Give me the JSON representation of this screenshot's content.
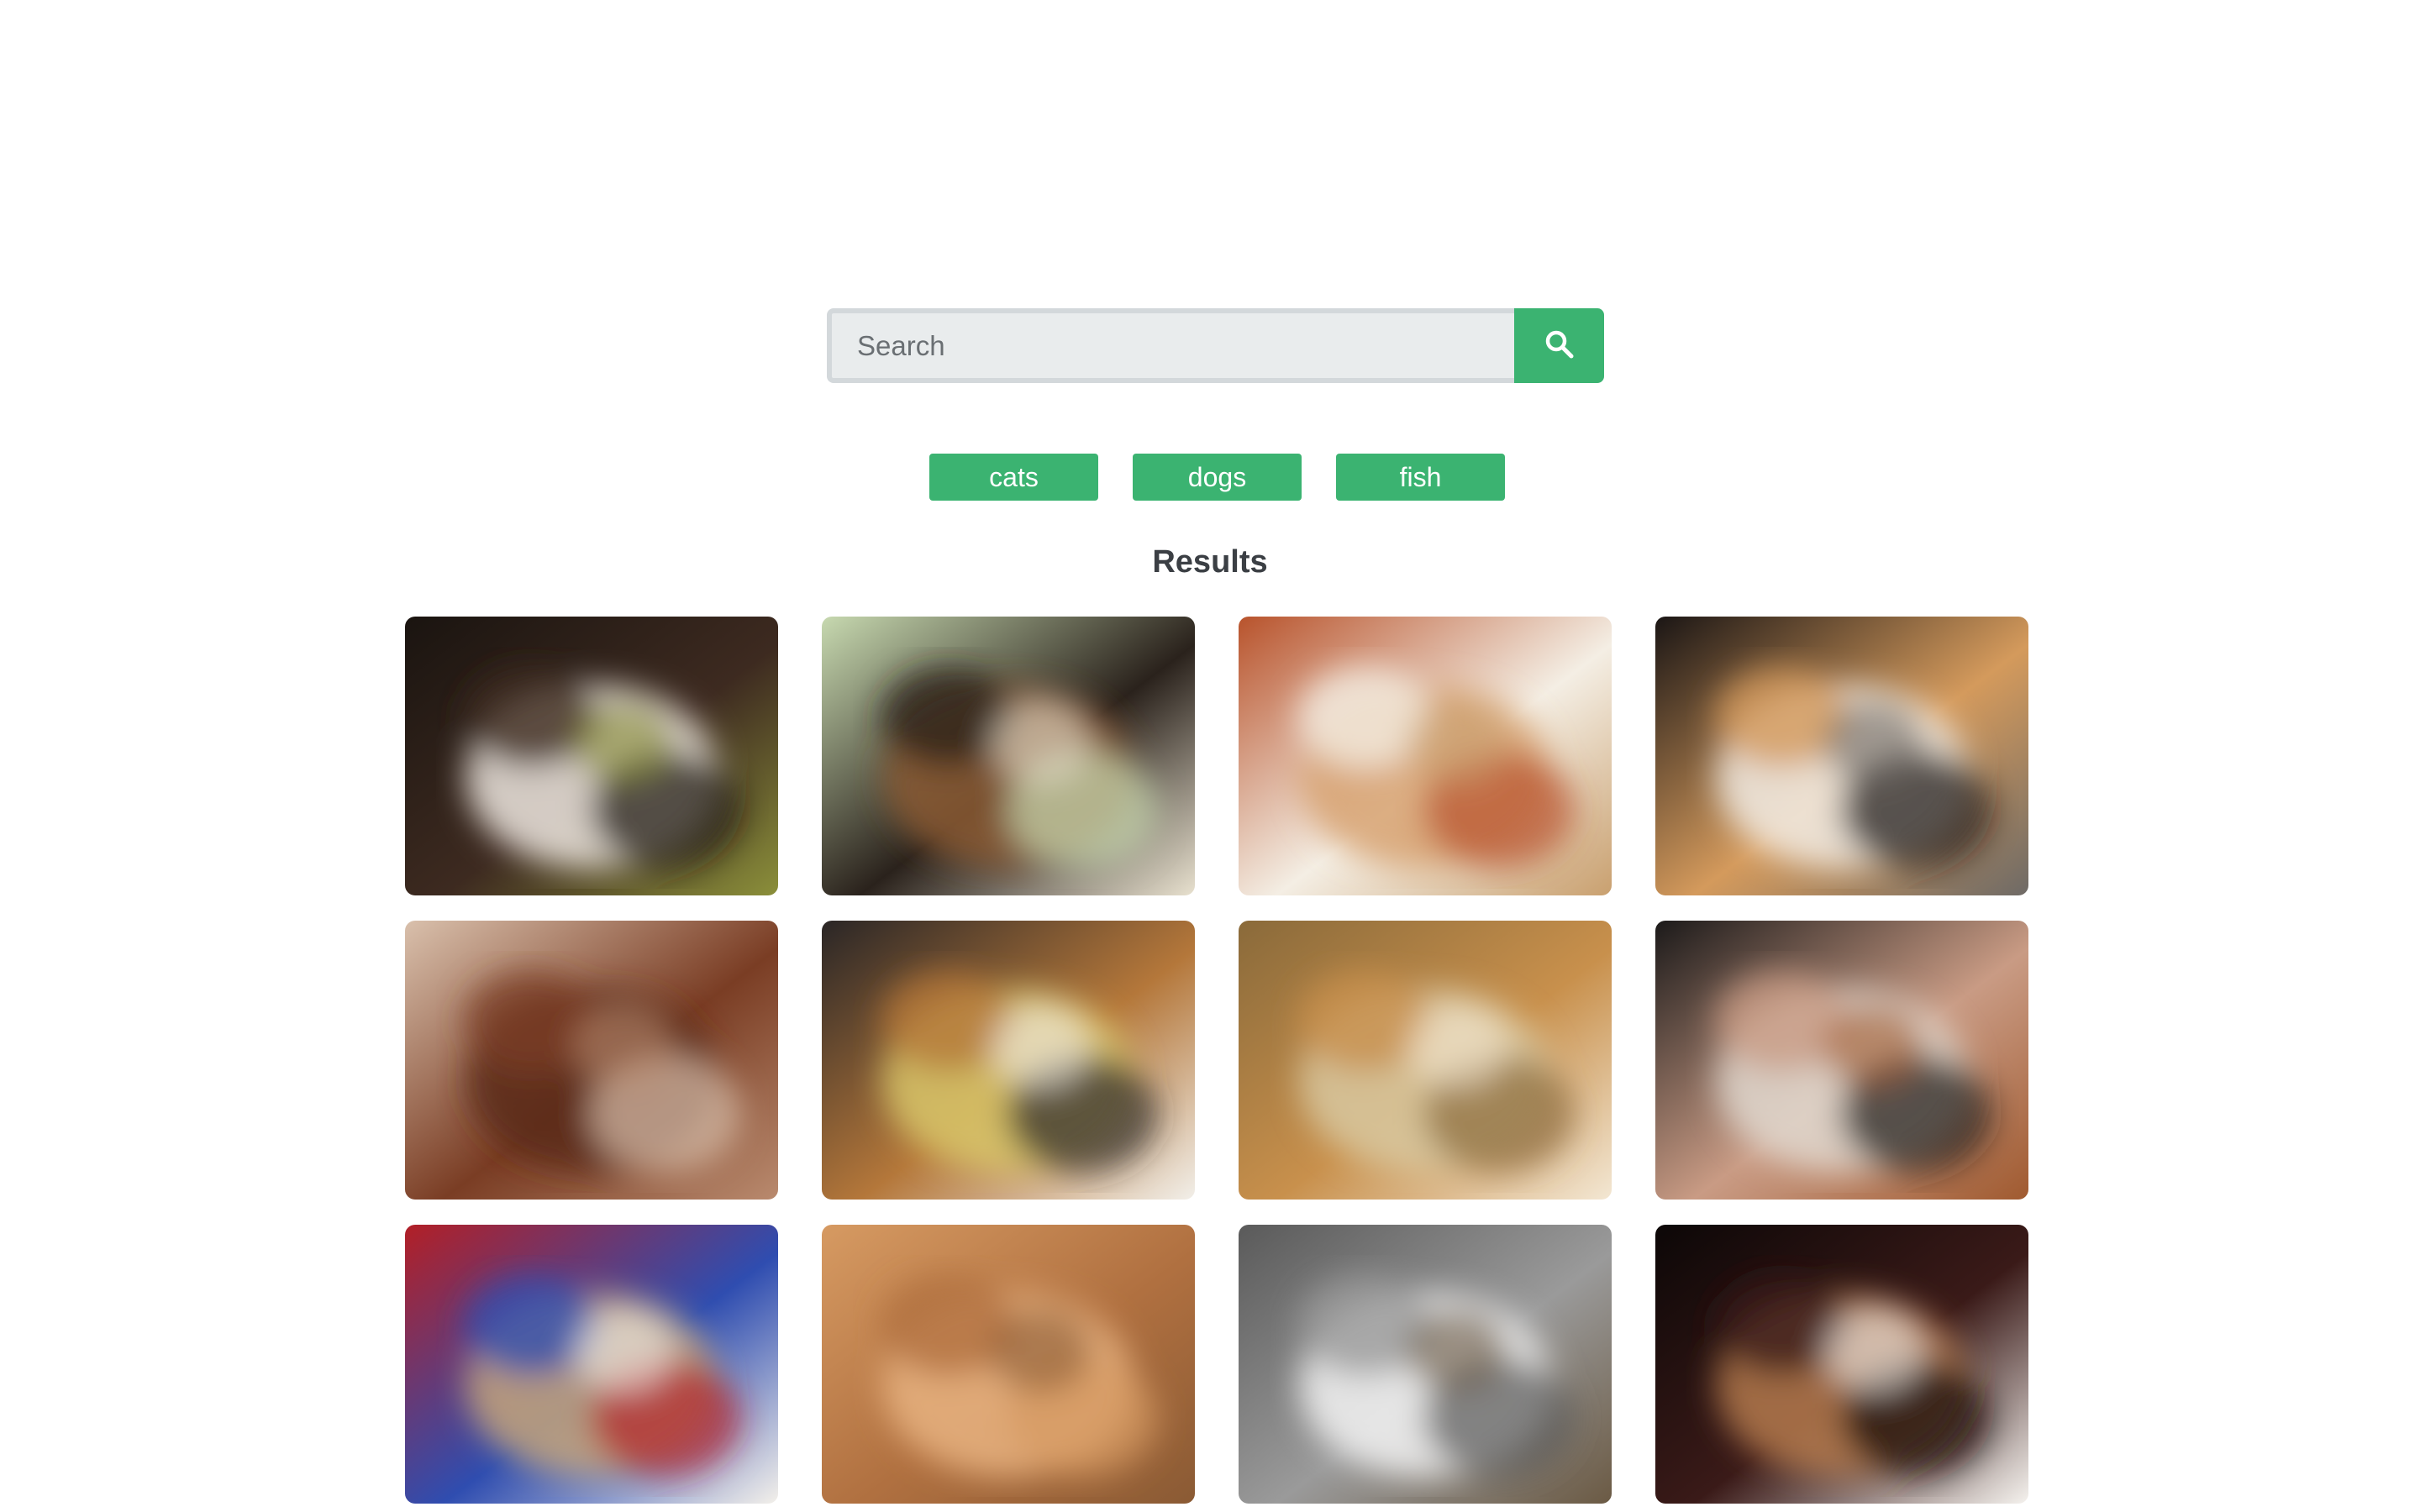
{
  "search": {
    "placeholder": "Search",
    "value": "",
    "button_icon": "search-icon"
  },
  "tags": [
    {
      "label": "cats"
    },
    {
      "label": "dogs"
    },
    {
      "label": "fish"
    }
  ],
  "results": {
    "title": "Results",
    "images": [
      {
        "subject": "black-and-white cat close-up",
        "colors": [
          "#1a1410",
          "#3d2a20",
          "#efe8e0",
          "#8b8f3a"
        ]
      },
      {
        "subject": "tortoiseshell cat on wooden arch",
        "colors": [
          "#c7d9b0",
          "#2a221c",
          "#8a5a34",
          "#e8e1cf"
        ]
      },
      {
        "subject": "calico cat by scratching post",
        "colors": [
          "#b8532c",
          "#f4eee4",
          "#d7a271",
          "#c9a06f"
        ]
      },
      {
        "subject": "calico cat sleeping",
        "colors": [
          "#1b1615",
          "#d49a5c",
          "#f1ece5",
          "#6e6a66"
        ]
      },
      {
        "subject": "brown dog lying on tiles",
        "colors": [
          "#d9c0ac",
          "#7a3d24",
          "#5a2a1a",
          "#b98a6e"
        ]
      },
      {
        "subject": "golden dog with antlers headband",
        "colors": [
          "#2a2626",
          "#b4773a",
          "#d8c56a",
          "#f2efe9"
        ]
      },
      {
        "subject": "golden dog lying on blanket",
        "colors": [
          "#8a6a3a",
          "#c8904c",
          "#d8c8a0",
          "#f3e7d3"
        ]
      },
      {
        "subject": "man with jack russell terrier",
        "colors": [
          "#1c1a1a",
          "#c99b84",
          "#e0d8cf",
          "#a05a30"
        ]
      },
      {
        "subject": "dog wearing festive hat",
        "colors": [
          "#b21f26",
          "#2f4db0",
          "#c6a579",
          "#f3f0ea"
        ]
      },
      {
        "subject": "blurry golden dog",
        "colors": [
          "#d69a62",
          "#b07040",
          "#e8b380",
          "#8a5a34"
        ]
      },
      {
        "subject": "white fluffy dog",
        "colors": [
          "#5a5a5a",
          "#9a9a9a",
          "#f2f2f2",
          "#6b5a44"
        ]
      },
      {
        "subject": "dog in hood and hat",
        "colors": [
          "#0c0707",
          "#3a1a18",
          "#b4794c",
          "#f5f2ee"
        ]
      }
    ]
  },
  "colors": {
    "accent": "#3bb371",
    "input_bg": "#e9eced",
    "input_border": "#d3d8db",
    "heading": "#3b3f44"
  }
}
